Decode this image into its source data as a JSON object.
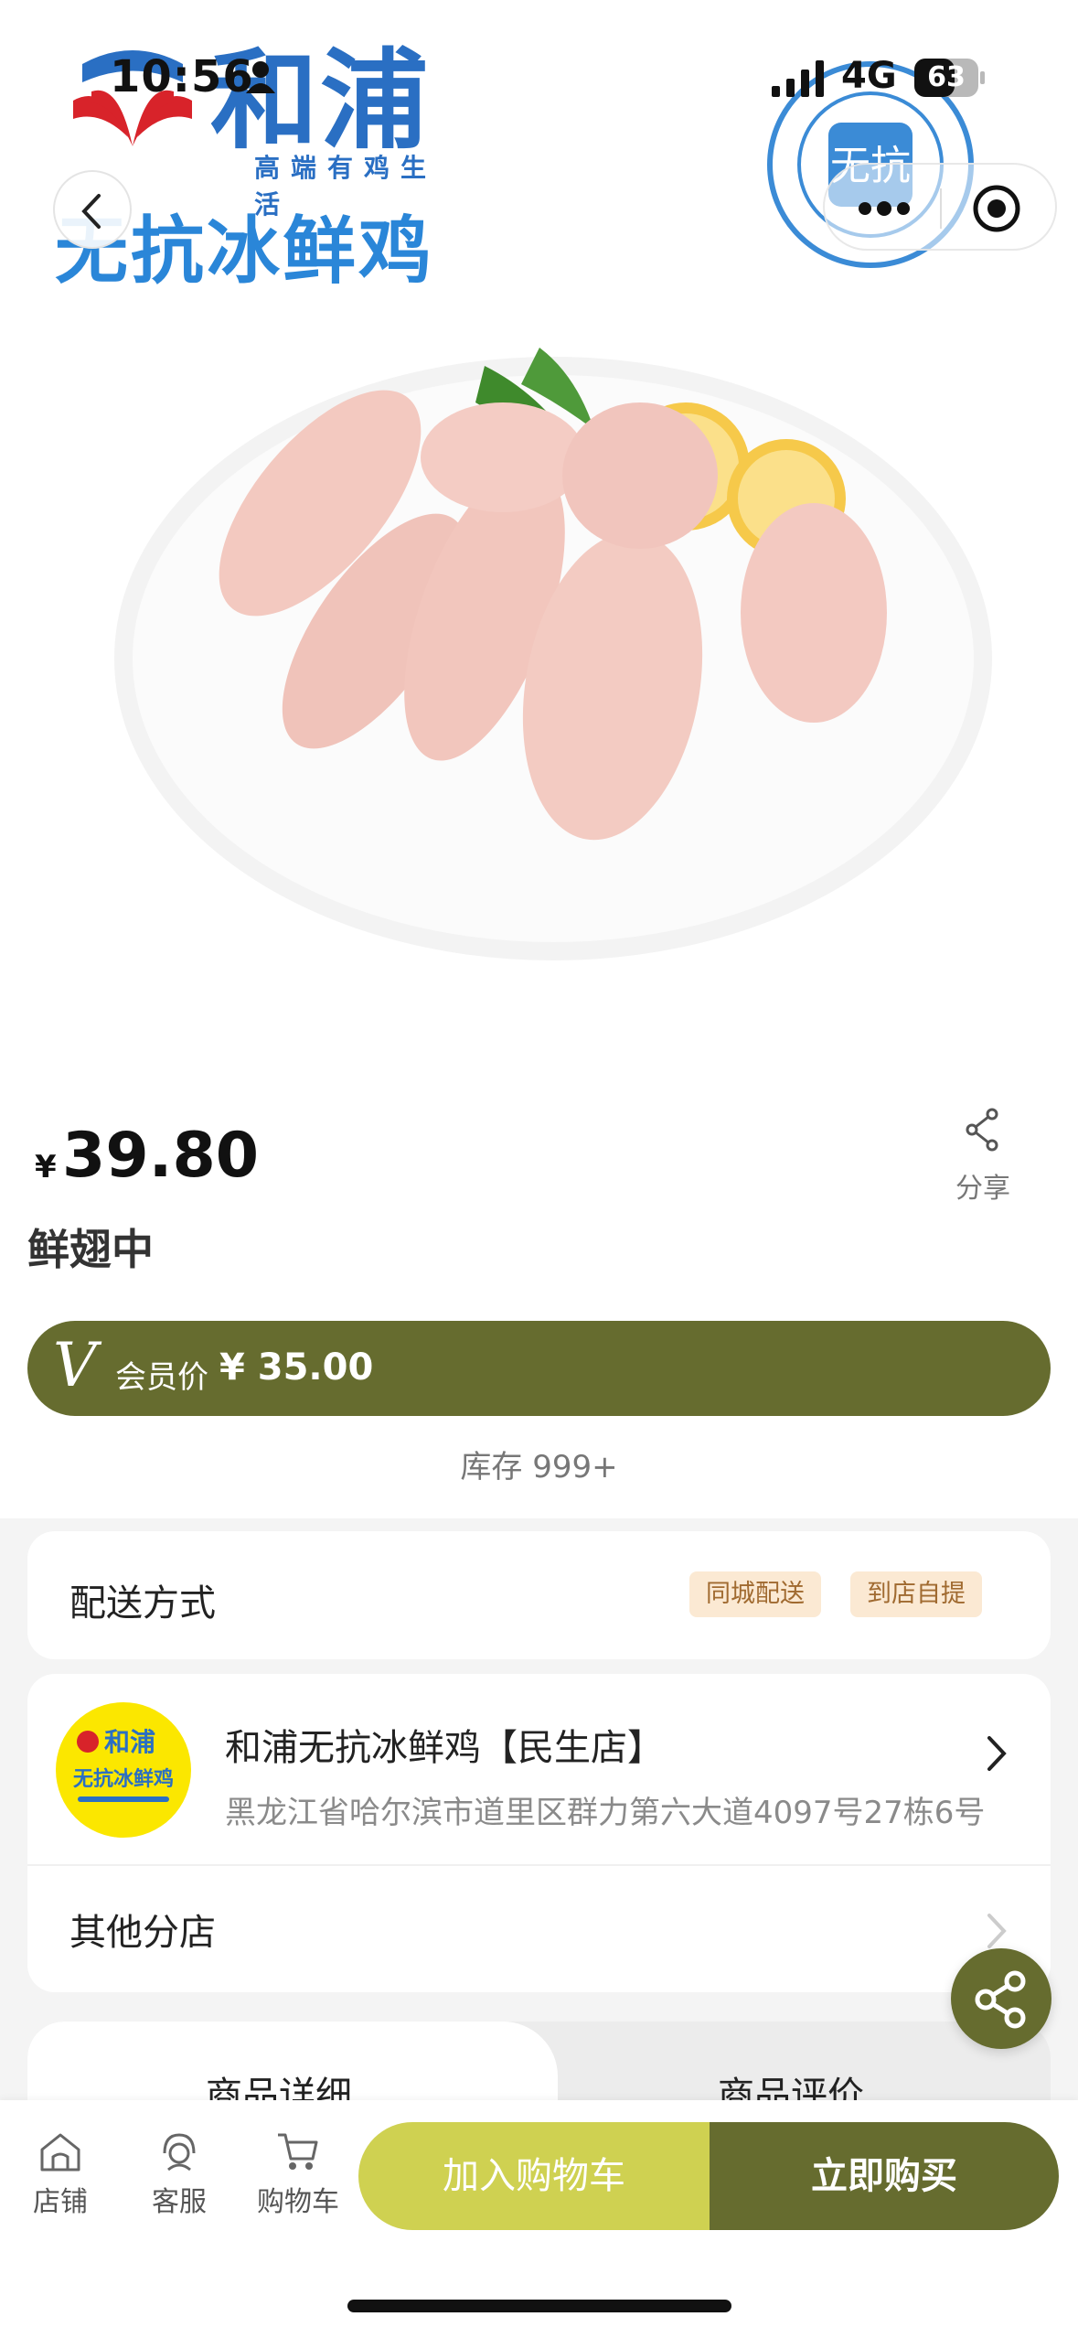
{
  "status_bar": {
    "time": "10:56",
    "network": "4G",
    "battery": "63",
    "battery_level": 0.63
  },
  "hero": {
    "brand_name": "和浦",
    "brand_slogan": "高端有鸡生活",
    "brand_product": "无抗冰鲜鸡",
    "seal_text": "无抗"
  },
  "product": {
    "currency": "¥",
    "price": "39.80",
    "name": "鲜翅中",
    "share_label": "分享",
    "member_label": "会员价",
    "member_price": "¥ 35.00",
    "member_v": "V",
    "stock": "库存 999+"
  },
  "delivery": {
    "title": "配送方式",
    "tags": [
      "同城配送",
      "到店自提"
    ]
  },
  "store": {
    "name": "和浦无抗冰鲜鸡【民生店】",
    "address": "黑龙江省哈尔滨市道里区群力第六大道4097号27栋6号",
    "logo_brand": "和浦",
    "logo_text": "无抗冰鲜鸡",
    "other_label": "其他分店"
  },
  "tabs": [
    "商品详细",
    "商品评价"
  ],
  "bottom_nav": [
    {
      "label": "店铺",
      "icon": "store-icon"
    },
    {
      "label": "客服",
      "icon": "customer-service-icon"
    },
    {
      "label": "购物车",
      "icon": "cart-icon"
    }
  ],
  "actions": {
    "add_to_cart": "加入购物车",
    "buy_now": "立即购买"
  },
  "colors": {
    "accent": "#666c2f",
    "cart_button": "#cfd151",
    "brand_blue": "#2a6fc3",
    "tag_bg": "#fbe9d3"
  }
}
